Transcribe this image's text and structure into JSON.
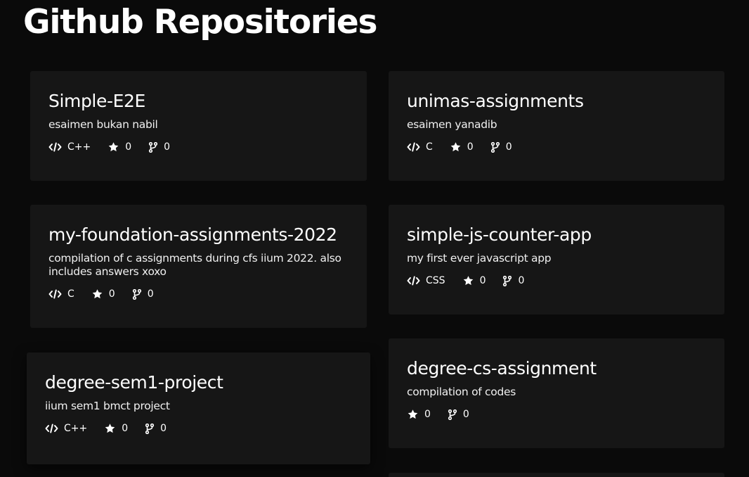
{
  "page": {
    "title": "Github Repositories"
  },
  "repos": [
    {
      "name": "Simple-E2E",
      "description": "esaimen bukan nabil",
      "language": "C++",
      "stars": "0",
      "forks": "0",
      "language_icon": "code-icon"
    },
    {
      "name": "unimas-assignments",
      "description": "esaimen yanadib",
      "language": "C",
      "stars": "0",
      "forks": "0",
      "language_icon": "code-icon"
    },
    {
      "name": "my-foundation-assignments-2022",
      "description": "compilation of c assignments during cfs iium 2022. also includes answers xoxo",
      "language": "C",
      "stars": "0",
      "forks": "0",
      "language_icon": "code-icon"
    },
    {
      "name": "simple-js-counter-app",
      "description": "my first ever javascript app",
      "language": "CSS",
      "stars": "0",
      "forks": "0",
      "language_icon": "code-icon"
    },
    {
      "name": "degree-sem1-project",
      "description": "iium sem1 bmct project",
      "language": "C++",
      "stars": "0",
      "forks": "0",
      "language_icon": "code-icon"
    },
    {
      "name": "degree-cs-assignment",
      "description": "compilation of codes",
      "stars": "0",
      "forks": "0"
    }
  ],
  "icons": {
    "language": "code-icon",
    "stars": "star-icon",
    "forks": "fork-icon"
  },
  "colors": {
    "background": "#0a0a0a",
    "card": "#161616",
    "text": "#ffffff"
  }
}
